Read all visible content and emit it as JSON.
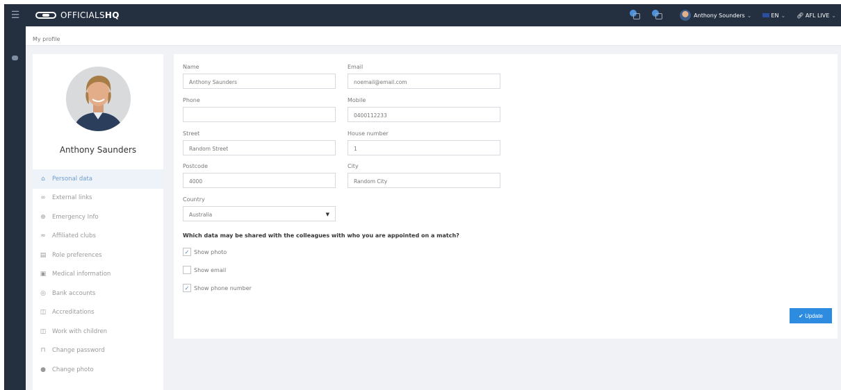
{
  "app": {
    "logo_text": "OFFICIALS",
    "logo_bold": "HQ"
  },
  "topbar": {
    "user_name": "Anthony Sounders",
    "language": "EN",
    "org": "AFL LIVE"
  },
  "breadcrumb": "My profile",
  "profile": {
    "name": "Anthony Saunders"
  },
  "menu": [
    {
      "label": "Personal data",
      "icon": "home-icon",
      "active": true
    },
    {
      "label": "External links",
      "icon": "link-icon",
      "active": false
    },
    {
      "label": "Emergency Info",
      "icon": "emergency-icon",
      "active": false
    },
    {
      "label": "Affiliated clubs",
      "icon": "handshake-icon",
      "active": false
    },
    {
      "label": "Role preferences",
      "icon": "list-icon",
      "active": false
    },
    {
      "label": "Medical information",
      "icon": "medical-icon",
      "active": false
    },
    {
      "label": "Bank accounts",
      "icon": "piggy-bank-icon",
      "active": false
    },
    {
      "label": "Accreditations",
      "icon": "certificate-icon",
      "active": false
    },
    {
      "label": "Work with children",
      "icon": "children-icon",
      "active": false
    },
    {
      "label": "Change password",
      "icon": "lock-icon",
      "active": false
    },
    {
      "label": "Change photo",
      "icon": "camera-icon",
      "active": false
    }
  ],
  "form": {
    "name_label": "Name",
    "name_value": "Anthony Saunders",
    "email_label": "Email",
    "email_value": "noemail@email.com",
    "phone_label": "Phone",
    "phone_value": "",
    "mobile_label": "Mobile",
    "mobile_value": "0400112233",
    "street_label": "Street",
    "street_value": "Random Street",
    "house_label": "House number",
    "house_value": "1",
    "postcode_label": "Postcode",
    "postcode_value": "4000",
    "city_label": "City",
    "city_value": "Random City",
    "country_label": "Country",
    "country_value": "Australia",
    "share_question": "Which data may be shared with the colleagues with who you are appointed on a match?",
    "show_photo_label": "Show photo",
    "show_photo_checked": true,
    "show_email_label": "Show email",
    "show_email_checked": false,
    "show_phone_label": "Show phone number",
    "show_phone_checked": true,
    "update_label": "Update"
  },
  "colors": {
    "topbar": "#243040",
    "accent": "#2d8ce0",
    "active_menu": "#6e9ccc"
  }
}
